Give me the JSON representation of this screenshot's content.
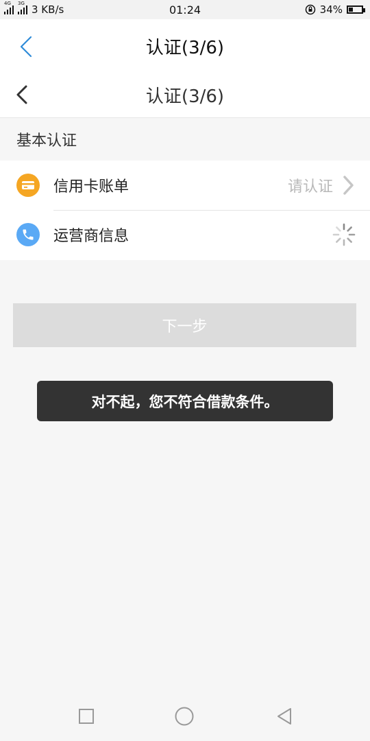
{
  "status_bar": {
    "network_1": "4G",
    "network_2": "3G",
    "speed": "3 KB/s",
    "time": "01:24",
    "battery": "34%",
    "battery_level": 0.34
  },
  "header_top": {
    "title": "认证(3/6)"
  },
  "header_second": {
    "title": "认证(3/6)"
  },
  "section": {
    "title": "基本认证"
  },
  "list": {
    "items": [
      {
        "label": "信用卡账单",
        "status": "请认证",
        "icon": "credit-card-icon",
        "icon_color": "#f5a623"
      },
      {
        "label": "运营商信息",
        "icon": "phone-icon",
        "icon_color": "#5aa9f5"
      }
    ]
  },
  "buttons": {
    "next": "下一步"
  },
  "toast": {
    "message": "对不起，您不符合借款条件。"
  },
  "colors": {
    "accent_blue": "#2e8bd8",
    "button_disabled": "#dcdcdc",
    "toast_bg": "#333333"
  }
}
